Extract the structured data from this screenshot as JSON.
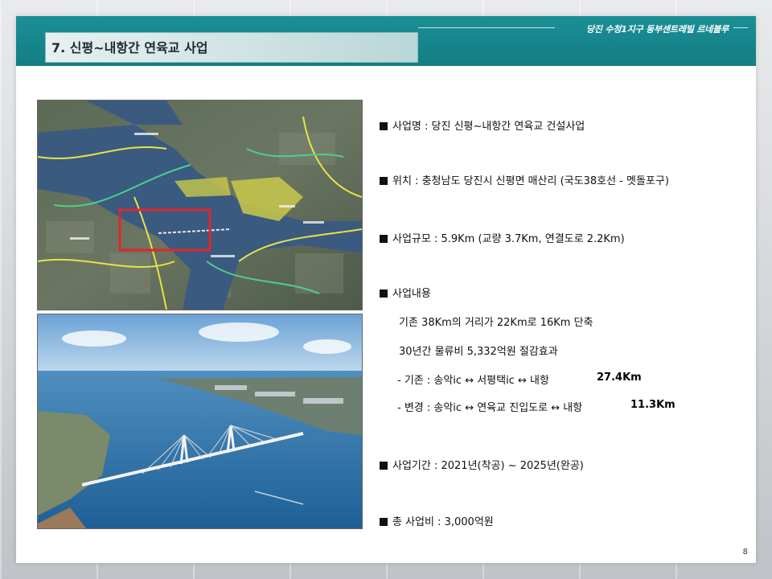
{
  "header": {
    "title": "7. 신평~내항간 연육교 사업",
    "brand": "당진 수청1지구 동부센트레빌 르네블루"
  },
  "images": {
    "map_icon": "satellite-map-image",
    "photo_icon": "bridge-aerial-rendering"
  },
  "items": [
    {
      "label": "사업명 : 당진 신평~내항간 연육교 건설사업"
    },
    {
      "label": "위치 : 충청남도 당진시 신평면 매산리 (국도38호선 - 멧돌포구)"
    },
    {
      "label": "사업규모 : 5.9Km (교량 3.7Km, 연결도로 2.2Km)"
    },
    {
      "label": "사업내용"
    },
    {
      "label": "사업기간 : 2021년(착공) ~ 2025년(완공)"
    },
    {
      "label": "총 사업비 : 3,000억원"
    }
  ],
  "details": {
    "line1": "기존 38Km의 거리가 22Km로 16Km 단축",
    "line2": "30년간 물류비 5,332억원 절감효과",
    "before_label": "- 기존 : 송악ic ↔ 서평택ic ↔ 내항",
    "before_distance": "27.4Km",
    "after_label": "- 변경 : 송악ic ↔ 연육교 진입도로 ↔ 내항",
    "after_distance": "11.3Km"
  },
  "page_number": "8",
  "colors": {
    "header": "#1b8f95",
    "highlight_box": "#e0262a",
    "sea": "#2b6fa6"
  }
}
